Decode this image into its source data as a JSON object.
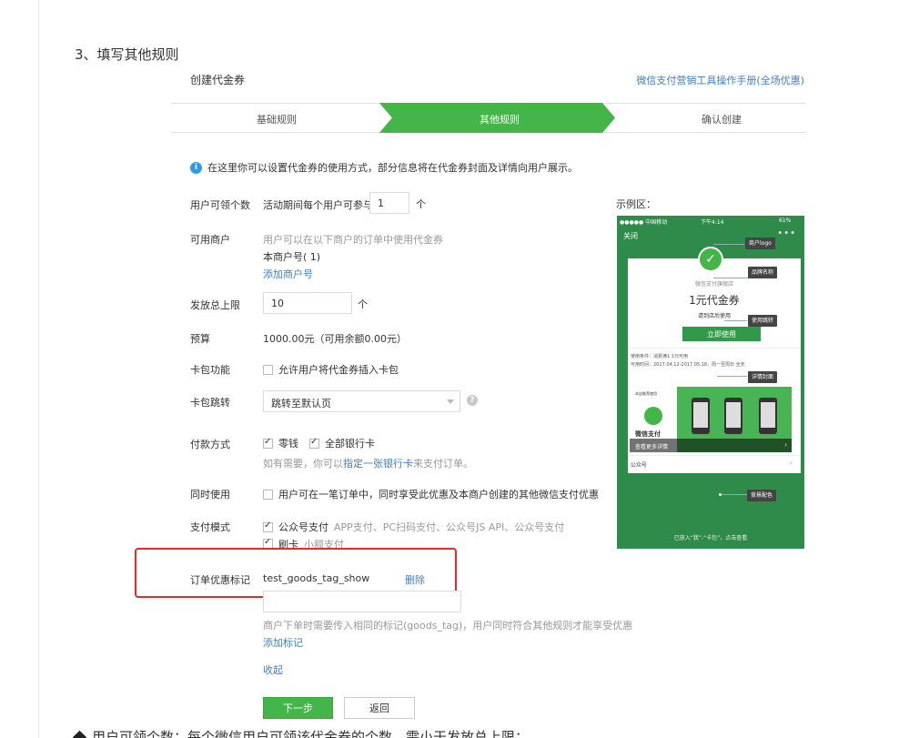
{
  "section": {
    "title": "3、填写其他规则"
  },
  "form": {
    "title": "创建代金券",
    "manual_link": "微信支付营销工具操作手册(全场优惠)"
  },
  "steps": [
    {
      "label": "基础规则",
      "active": false
    },
    {
      "label": "其他规则",
      "active": true
    },
    {
      "label": "确认创建",
      "active": false
    }
  ],
  "info": {
    "icon": "info-icon",
    "text": "在这里你可以设置代金券的使用方式，部分信息将在代金券封面及详情向用户展示。"
  },
  "fields": {
    "per_user": {
      "label": "用户可领个数",
      "prefix": "活动期间每个用户可参与",
      "value": "1",
      "suffix": "个"
    },
    "merchants": {
      "label": "可用商户",
      "hint": "用户可以在以下商户的订单中使用代金券",
      "merchant_id": "本商户号(          1)",
      "add_link": "添加商户号"
    },
    "total_limit": {
      "label": "发放总上限",
      "value": "10",
      "suffix": "个"
    },
    "budget": {
      "label": "预算",
      "value": "1000.00元（可用余额0.00元）"
    },
    "card_pack": {
      "label": "卡包功能",
      "checked": false,
      "option": "允许用户将代金券插入卡包"
    },
    "card_jump": {
      "label": "卡包跳转",
      "selected": "跳转至默认页",
      "help_icon": "help-icon"
    },
    "payment": {
      "label": "付款方式",
      "options": [
        {
          "label": "零钱",
          "checked": true
        },
        {
          "label": "全部银行卡",
          "checked": true
        }
      ],
      "hint_prefix": "如有需要，你可以",
      "hint_link": "指定一张银行卡",
      "hint_suffix": "来支付订单。"
    },
    "same_time": {
      "label": "同时使用",
      "checked": false,
      "option": "用户可在一笔订单中，同时享受此优惠及本商户创建的其他微信支付优惠"
    },
    "pay_mode": {
      "label": "支付模式",
      "options": [
        {
          "label": "公众号支付",
          "detail": "APP支付、PC扫码支付、公众号JS API、公众号支付",
          "checked": true
        },
        {
          "label": "刷卡",
          "detail": "小额支付",
          "checked": true
        }
      ]
    },
    "goods_tag": {
      "label": "订单优惠标记",
      "value": "test_goods_tag_show",
      "delete": "删除",
      "hint": "商户下单时需要传入相同的标记(goods_tag)，用户同时符合其他规则才能享受优惠",
      "add_link": "添加标记",
      "collapse": "收起"
    }
  },
  "buttons": {
    "next": "下一步",
    "back": "返回"
  },
  "bottom_note": "用户可领个数：每个微信用户可领该代金券的个数，需小于发放总上限；",
  "preview": {
    "label": "示例区：",
    "status": {
      "carrier": "●●●●● 中国移动",
      "time": "下午4:14",
      "battery": "61%"
    },
    "close": "关闭",
    "more": "•••",
    "store": "微信支付旗舰店",
    "coupon": "1元代金券",
    "store_hint": "请到店后使用",
    "use_button": "立即使用",
    "condition": "使用条件：消费满1.1元可用",
    "period": "可用时间：2017.04.12-2017.05.18，周一至周日 全天",
    "cover_caption": "微信支付",
    "cover_sub": "本店推荐使用",
    "see_more": "查看更多详情",
    "official": "公众号",
    "footer": "已放入“我”-“卡包”，点击查看",
    "callouts": [
      "商户logo",
      "品牌名称",
      "使用跳转",
      "详情封面",
      "背景配色"
    ]
  }
}
